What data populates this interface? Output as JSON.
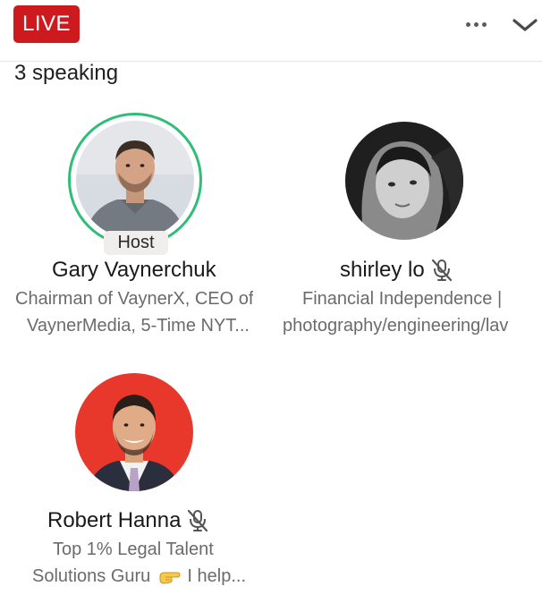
{
  "header": {
    "live_label": "LIVE",
    "more_icon": "more-horizontal-icon",
    "collapse_icon": "chevron-down-icon"
  },
  "speaking_count": "3 speaking",
  "speakers": [
    {
      "name": "Gary Vaynerchuk",
      "role_badge": "Host",
      "desc_line1": "Chairman of VaynerX, CEO of",
      "desc_line2": "VaynerMedia, 5-Time NYT...",
      "muted": false
    },
    {
      "name": "shirley lo",
      "desc_line1": "Financial Independence |",
      "desc_line2": "photography/engineering/lav",
      "muted": true
    },
    {
      "name": "Robert Hanna",
      "desc_line1": "Top 1% Legal Talent",
      "desc_line2_before": "Solutions Guru ",
      "desc_line2_after": " I help...",
      "muted": true
    }
  ],
  "colors": {
    "live_red": "#cc1a1f",
    "host_ring_green": "#2fbd78",
    "red_background": "#e8382b"
  }
}
